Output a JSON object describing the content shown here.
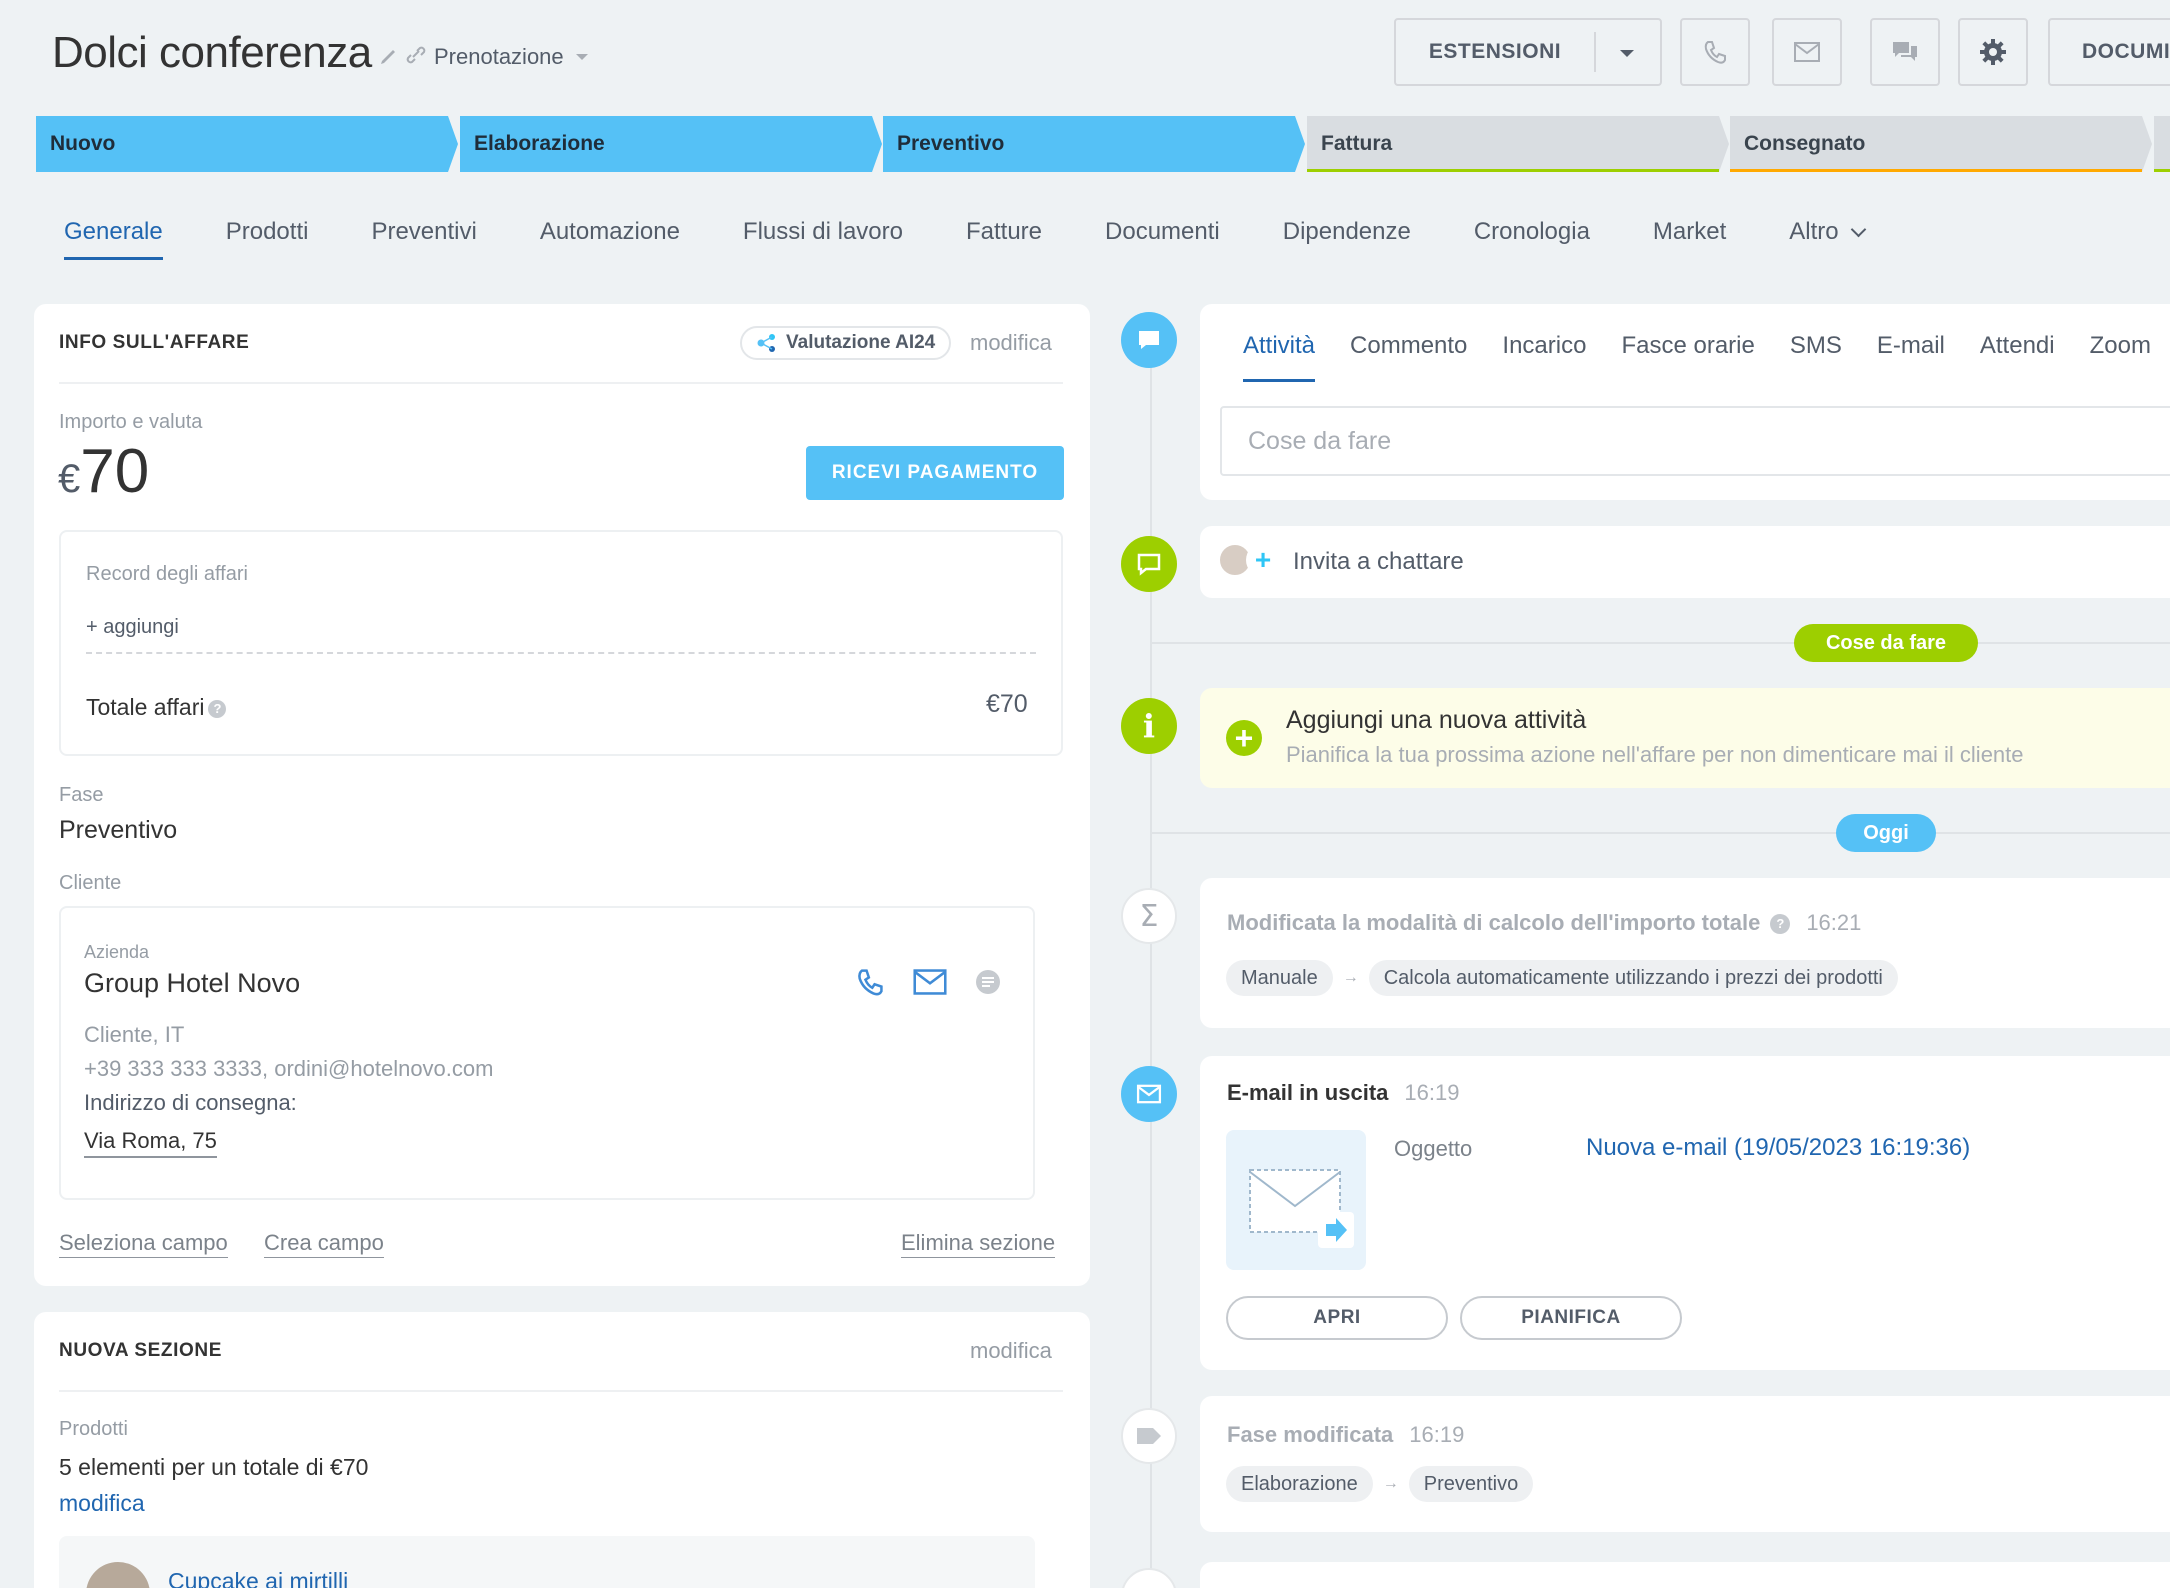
{
  "header": {
    "title": "Dolci conferenza",
    "category": "Prenotazione",
    "extensions_label": "ESTENSIONI",
    "documents_label": "DOCUMI",
    "icons": [
      "pencil-icon",
      "link-icon",
      "phone-icon",
      "mail-icon",
      "chat-icon",
      "gear-icon"
    ]
  },
  "stages": [
    {
      "label": "Nuovo",
      "state": "done",
      "color": "#55c1f6"
    },
    {
      "label": "Elaborazione",
      "state": "done",
      "color": "#55c1f6"
    },
    {
      "label": "Preventivo",
      "state": "current",
      "color": "#55c1f6"
    },
    {
      "label": "Fattura",
      "state": "todo",
      "color": "#d9dde1",
      "bar": "#9dcf00"
    },
    {
      "label": "Consegnato",
      "state": "todo",
      "color": "#d9dde1",
      "bar": "#ffa900"
    }
  ],
  "tabs": [
    "Generale",
    "Prodotti",
    "Preventivi",
    "Automazione",
    "Flussi di lavoro",
    "Fatture",
    "Documenti",
    "Dipendenze",
    "Cronologia",
    "Market",
    "Altro"
  ],
  "active_tab": "Generale",
  "deal_info": {
    "section_title": "INFO SULL'AFFARE",
    "ai_badge": "Valutazione AI24",
    "edit": "modifica",
    "amount_label": "Importo e valuta",
    "currency": "€",
    "amount": "70",
    "pay_button": "RICEVI PAGAMENTO",
    "records_label": "Record degli affari",
    "add_link": "+ aggiungi",
    "total_label": "Totale affari",
    "total_value": "€70",
    "stage_label": "Fase",
    "stage_value": "Preventivo",
    "client_label": "Cliente",
    "company_label": "Azienda",
    "company_name": "Group Hotel Novo",
    "client_meta": "Cliente, IT",
    "contacts": "+39 333 333 3333, ordini@hotelnovo.com",
    "address_label": "Indirizzo di consegna:",
    "address": "Via Roma, 75",
    "select_field": "Seleziona campo",
    "create_field": "Crea campo",
    "delete_section": "Elimina sezione"
  },
  "new_section": {
    "title": "NUOVA SEZIONE",
    "edit": "modifica",
    "products_label": "Prodotti",
    "products_summary": "5 elementi per un totale di €70",
    "products_edit": "modifica",
    "first_product": "Cupcake ai mirtilli"
  },
  "activity": {
    "tabs": [
      "Attività",
      "Commento",
      "Incarico",
      "Fasce orarie",
      "SMS",
      "E-mail",
      "Attendi",
      "Zoom"
    ],
    "active_tab": "Attività",
    "todo_placeholder": "Cose da fare",
    "invite_chat": "Invita a chattare",
    "todo_pill": "Cose da fare",
    "new_activity_title": "Aggiungi una nuova attività",
    "new_activity_sub": "Pianifica la tua prossima azione nell'affare per non dimenticare mai il cliente",
    "today_pill": "Oggi",
    "calc_change": {
      "title": "Modificata la modalità di calcolo dell'importo totale",
      "time": "16:21",
      "from": "Manuale",
      "to": "Calcola automaticamente utilizzando i prezzi dei prodotti"
    },
    "email": {
      "title": "E-mail in uscita",
      "time": "16:19",
      "subject_label": "Oggetto",
      "subject": "Nuova e-mail (19/05/2023 16:19:36)",
      "open_btn": "APRI",
      "schedule_btn": "PIANIFICA"
    },
    "stage_change": {
      "title": "Fase modificata",
      "time": "16:19",
      "from": "Elaborazione",
      "to": "Preventivo"
    }
  }
}
